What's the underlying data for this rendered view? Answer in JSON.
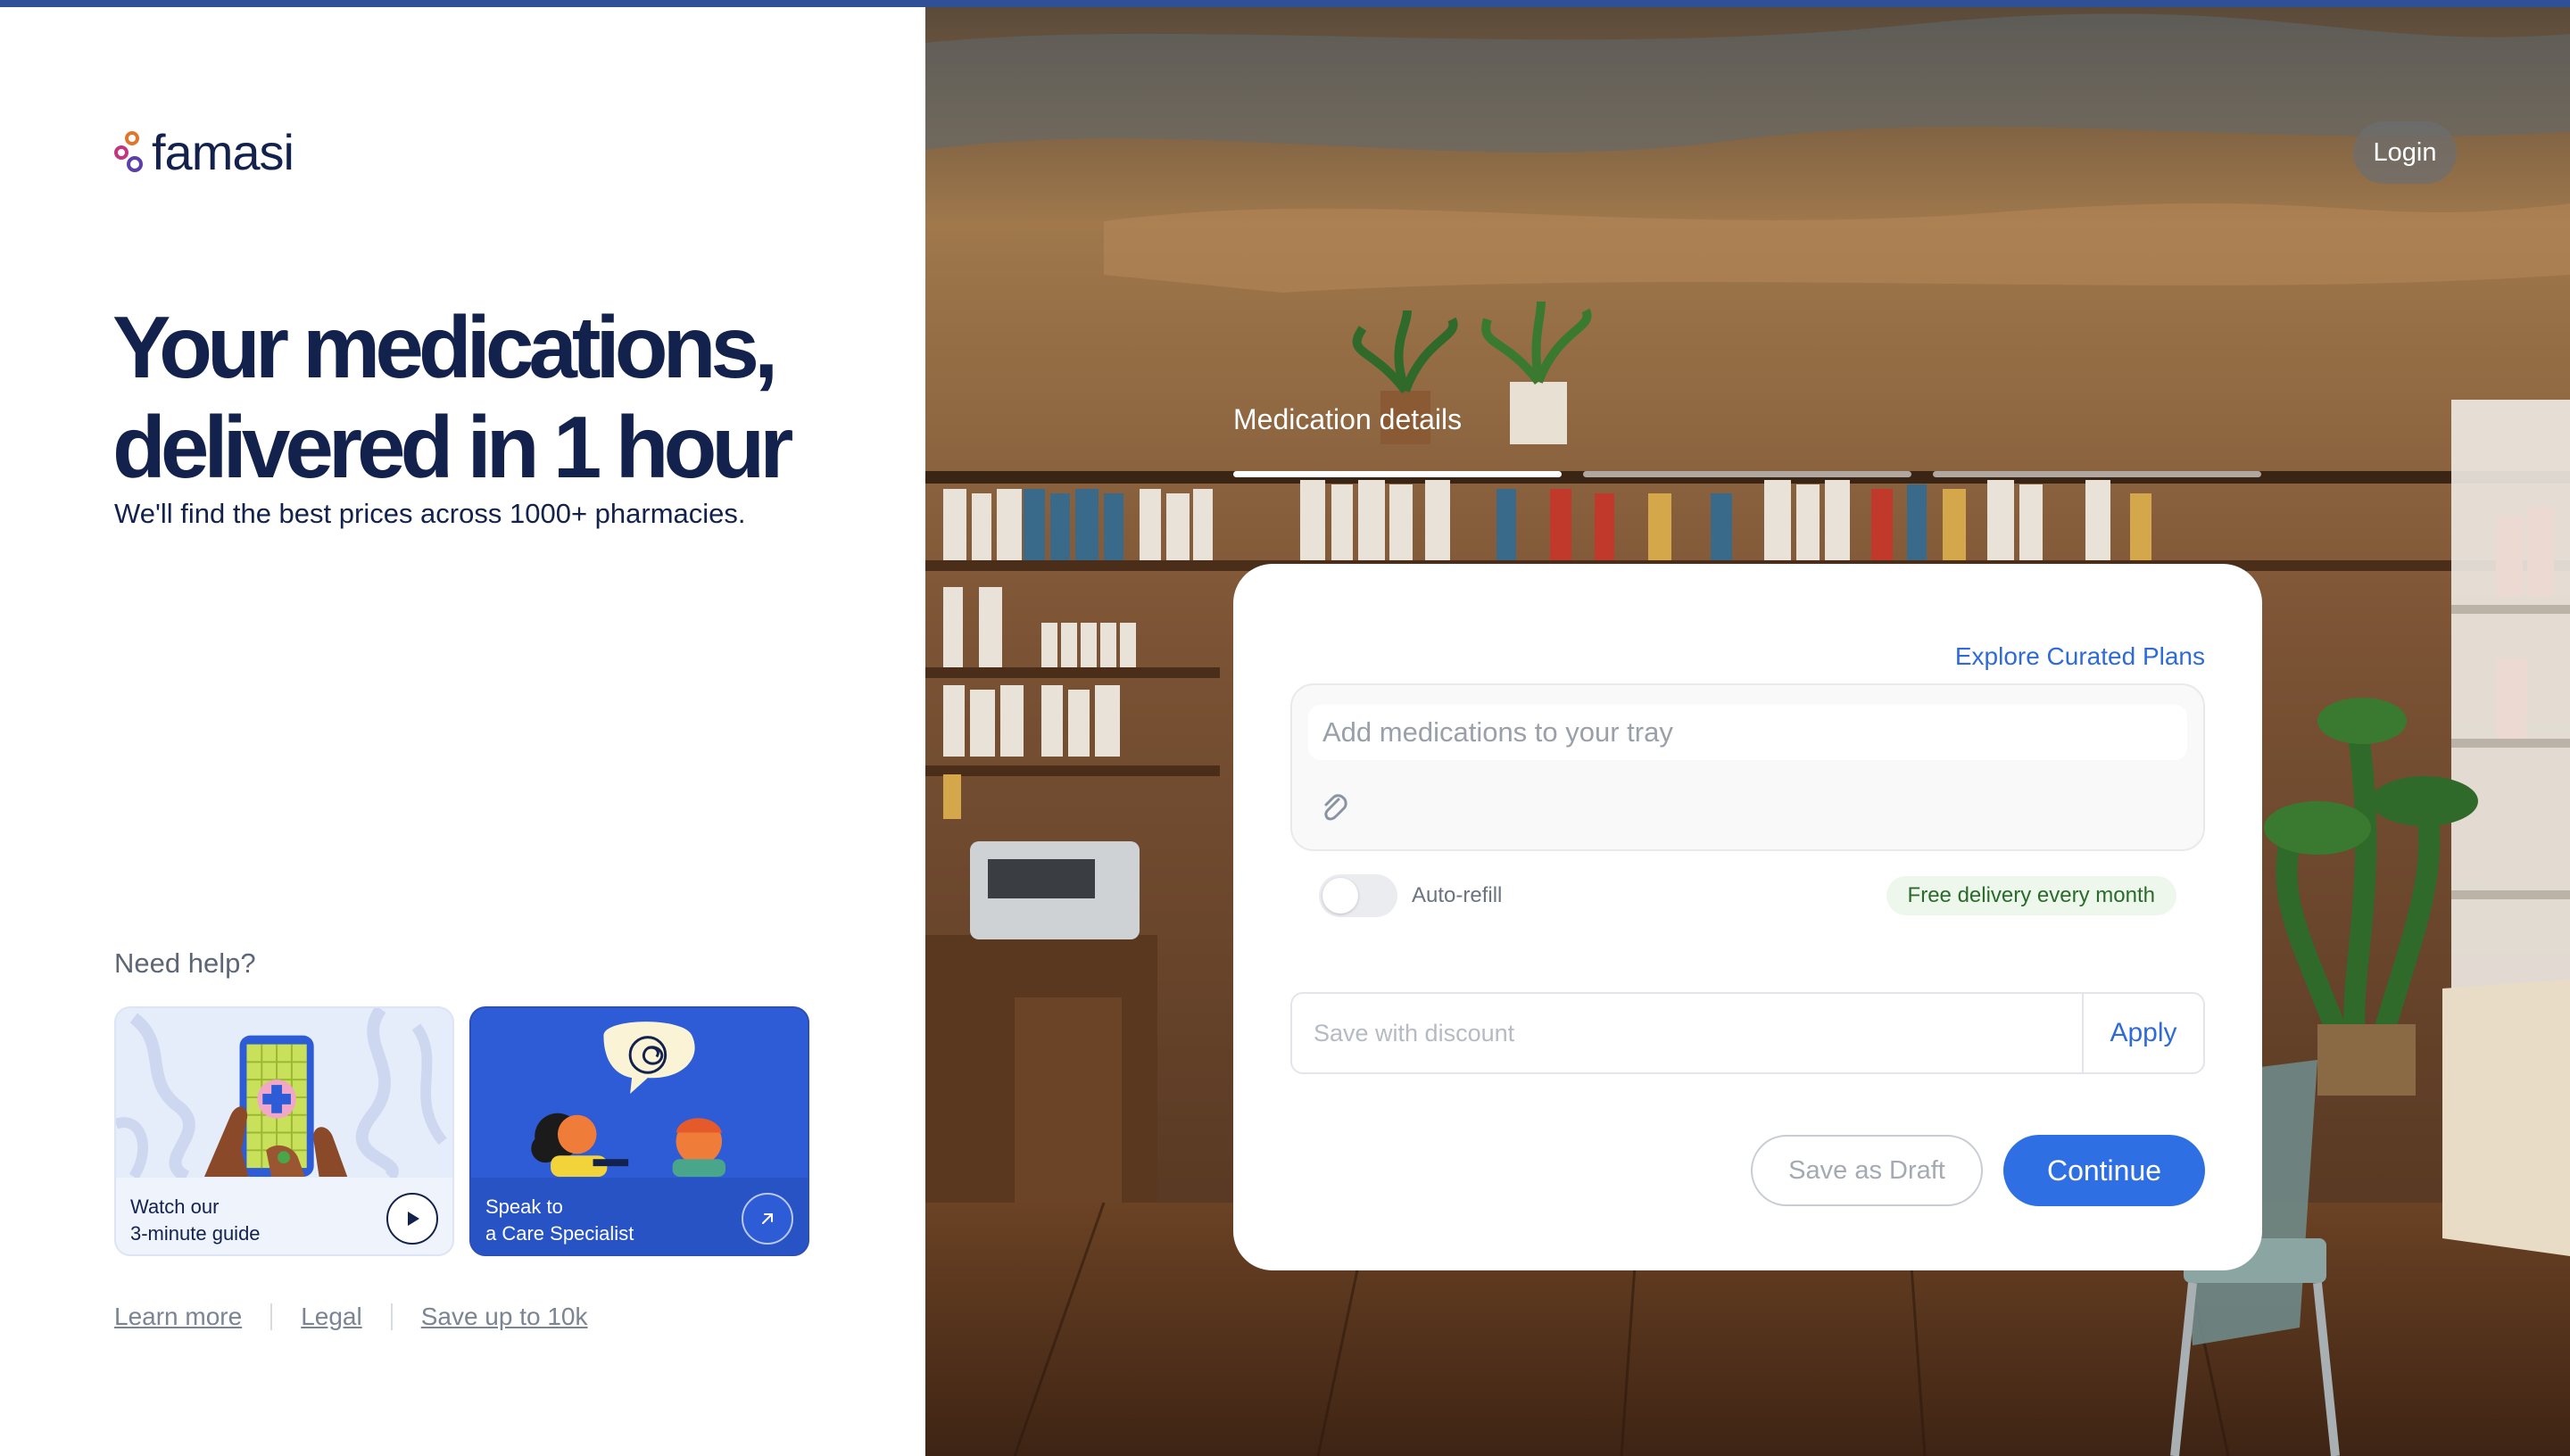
{
  "brand": {
    "name": "famasi"
  },
  "hero": {
    "title_line1": "Your medications,",
    "title_line2": "delivered in 1 hour",
    "subtitle": "We'll find the best prices across 1000+ pharmacies."
  },
  "help": {
    "title": "Need help?",
    "cards": [
      {
        "line1": "Watch our",
        "line2": "3-minute guide",
        "icon": "play-icon"
      },
      {
        "line1": "Speak to",
        "line2": "a Care Specialist",
        "icon": "arrow-up-right-icon"
      }
    ]
  },
  "footer_links": [
    "Learn more",
    "Legal",
    "Save up to 10k"
  ],
  "header": {
    "login_label": "Login"
  },
  "stepper": {
    "label": "Medication details",
    "steps_total": 3,
    "active_step": 1
  },
  "form": {
    "explore_link": "Explore Curated Plans",
    "tray_placeholder": "Add medications to your tray",
    "auto_refill_label": "Auto-refill",
    "auto_refill_on": false,
    "delivery_badge": "Free delivery every month",
    "discount_placeholder": "Save with discount",
    "apply_label": "Apply",
    "draft_label": "Save as Draft",
    "continue_label": "Continue"
  },
  "colors": {
    "brand_navy": "#13224d",
    "accent_blue": "#2f6fe4",
    "link_blue": "#2e6bd8",
    "top_bar": "#2f4f96",
    "badge_green_bg": "#eef7ec",
    "badge_green_text": "#2a6b2c"
  }
}
